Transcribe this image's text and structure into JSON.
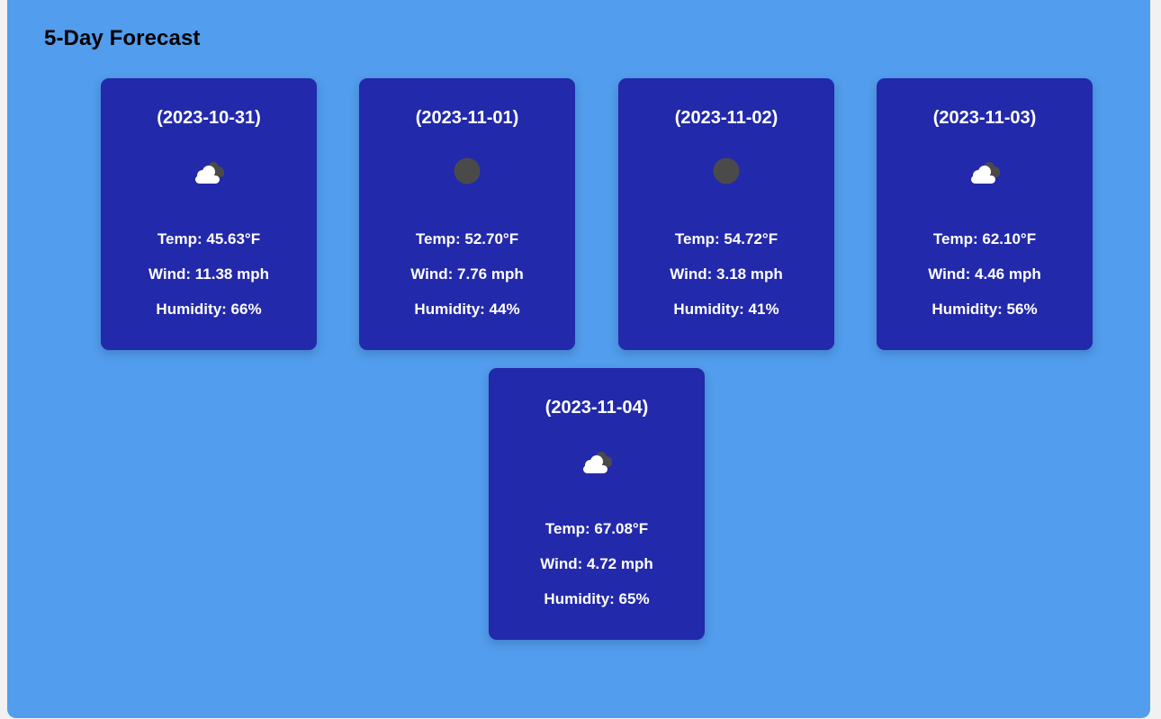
{
  "header": {
    "title": "5-Day Forecast"
  },
  "labels": {
    "temp": "Temp:",
    "wind": "Wind:",
    "humidity": "Humidity:"
  },
  "colors": {
    "panel_background": "#529ded",
    "card_background": "#2229aa",
    "text": "#ffffff",
    "title": "#000000",
    "cloud_front": "#ffffff",
    "cloud_back": "#4a4a4a"
  },
  "forecast": [
    {
      "date": "(2023-10-31)",
      "icon": "partly-cloudy-icon",
      "temp": "Temp: 45.63°F",
      "wind": "Wind: 11.38 mph",
      "humidity": "Humidity: 66%"
    },
    {
      "date": "(2023-11-01)",
      "icon": "clear-night-icon",
      "temp": "Temp: 52.70°F",
      "wind": "Wind: 7.76 mph",
      "humidity": "Humidity: 44%"
    },
    {
      "date": "(2023-11-02)",
      "icon": "clear-night-icon",
      "temp": "Temp: 54.72°F",
      "wind": "Wind: 3.18 mph",
      "humidity": "Humidity: 41%"
    },
    {
      "date": "(2023-11-03)",
      "icon": "partly-cloudy-icon",
      "temp": "Temp: 62.10°F",
      "wind": "Wind: 4.46 mph",
      "humidity": "Humidity: 56%"
    },
    {
      "date": "(2023-11-04)",
      "icon": "partly-cloudy-icon",
      "temp": "Temp: 67.08°F",
      "wind": "Wind: 4.72 mph",
      "humidity": "Humidity: 65%"
    }
  ]
}
